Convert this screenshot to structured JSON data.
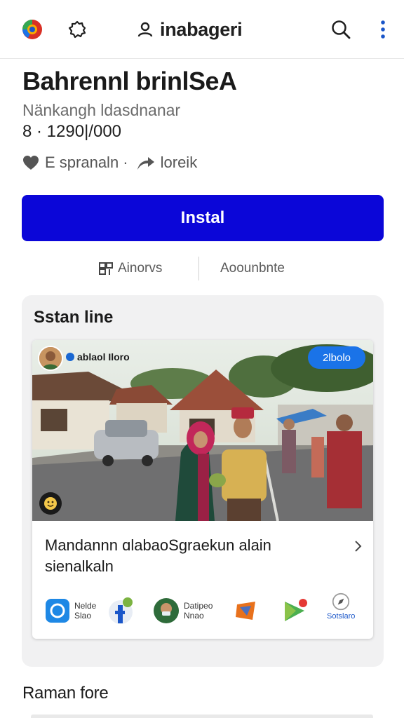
{
  "topbar": {
    "title": "inabageri",
    "icons": [
      "store-logo-icon",
      "gear-icon",
      "account-icon",
      "search-icon",
      "more-vert-icon"
    ]
  },
  "app": {
    "title": "Bahrennl brinlSeA",
    "developer": "Nänkangh ldasdnanar",
    "downloads": "8 · 1290|/000",
    "wishlist_label": "E spranaln ·",
    "share_label": "loreik"
  },
  "install": {
    "label": "Instal"
  },
  "secondary": {
    "left_label": "Ainorvs",
    "right_label": "Aoounbnte"
  },
  "section": {
    "title": "Sstan line",
    "post": {
      "author": "ablaol Iloro",
      "follow_label": "2lbolo",
      "caption": "Mandannn ɑlabaoSgraekun alain sienalkaln"
    },
    "apps": [
      {
        "name": "Nelde",
        "sub": "Slao"
      },
      {
        "name": "Datipeo",
        "sub": "Nnao"
      },
      {
        "name": "Sotslaro"
      }
    ]
  },
  "more": {
    "title": "Raman fore"
  },
  "colors": {
    "install_bg": "#0b06d8",
    "follow_bg": "#1a73e8",
    "section_bg": "#f1f1f2"
  }
}
